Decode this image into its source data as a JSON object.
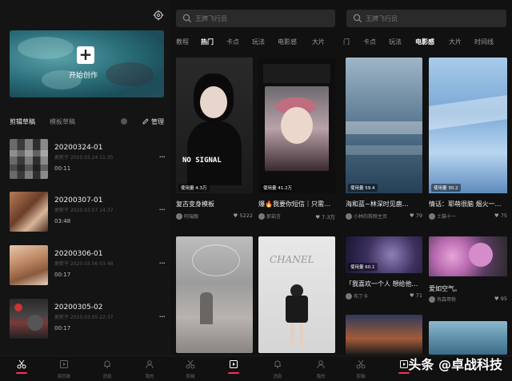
{
  "editor": {
    "create_label": "开始创作",
    "draft_tabs": [
      "剪辑草稿",
      "模板草稿"
    ],
    "manage_label": "管理",
    "drafts": [
      {
        "name": "20200324-01",
        "updated": "更新于 2020.03.24 11:35",
        "duration": "00:11"
      },
      {
        "name": "20200307-01",
        "updated": "更新于 2020.03.07 14:37",
        "duration": "03:48"
      },
      {
        "name": "20200306-01",
        "updated": "更新于 2020.03.06 03:48",
        "duration": "00:17"
      },
      {
        "name": "20200305-02",
        "updated": "更新于 2020.03.05 22:37",
        "duration": "00:17"
      }
    ],
    "more_glyph": "···"
  },
  "tabbar": {
    "items": [
      "剪辑",
      "剪同款",
      "消息",
      "我的"
    ]
  },
  "templates_left": {
    "search_placeholder": "王牌飞行员",
    "categories": [
      "教程",
      "热门",
      "卡点",
      "玩法",
      "电影感",
      "大片"
    ],
    "active_category": "热门",
    "cards": [
      {
        "usage": "使用量 4.3万",
        "title": "复古变身模板",
        "author": "阿瑞靓",
        "likes": "5222"
      },
      {
        "usage": "使用量 41.2万",
        "title": "爆🔥我要你短信｜只需…",
        "author": "那茹言",
        "likes": "7.3万"
      },
      {
        "usage": "",
        "title": "",
        "author": "",
        "likes": ""
      },
      {
        "usage": "",
        "title": "",
        "author": "",
        "likes": ""
      }
    ]
  },
  "templates_right": {
    "search_placeholder": "王牌飞行员",
    "categories": [
      "门",
      "卡点",
      "玩法",
      "电影感",
      "大片",
      "时间线"
    ],
    "active_category": "电影感",
    "cards": [
      {
        "usage": "使用量 59.4",
        "title": "海和蓝~林深时见鹿…",
        "author": "小林的剪映主页",
        "likes": "79"
      },
      {
        "usage": "使用量 30.2",
        "title": "情话：耶萌很脑 烟火一…",
        "author": "土猫十一",
        "likes": "75"
      },
      {
        "usage": "使用量 60.1",
        "title": "「我喜欢一个人 想给他…",
        "author": "布丁卡",
        "likes": "71"
      },
      {
        "usage": "",
        "title": "爱如空气。",
        "author": "有森哥粉",
        "likes": "95"
      }
    ]
  },
  "watermark": "头条 @卓战科技"
}
